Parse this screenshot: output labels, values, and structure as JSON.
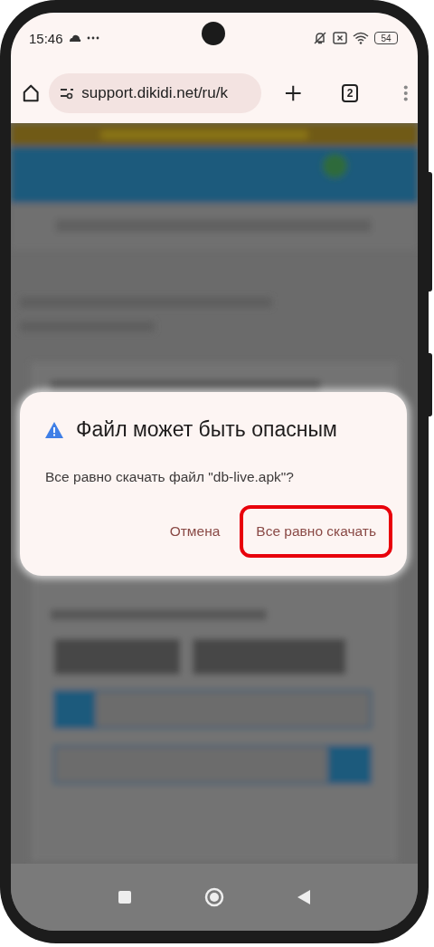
{
  "status_bar": {
    "time": "15:46",
    "battery": "54"
  },
  "browser_toolbar": {
    "url": "support.dikidi.net/ru/k",
    "tab_count": "2"
  },
  "dialog": {
    "title": "Файл может быть опасным",
    "message": "Все равно скачать файл \"db-live.apk\"?",
    "buttons": [
      {
        "label": "Отмена",
        "highlighted": false
      },
      {
        "label": "Все равно скачать",
        "highlighted": true
      }
    ]
  }
}
